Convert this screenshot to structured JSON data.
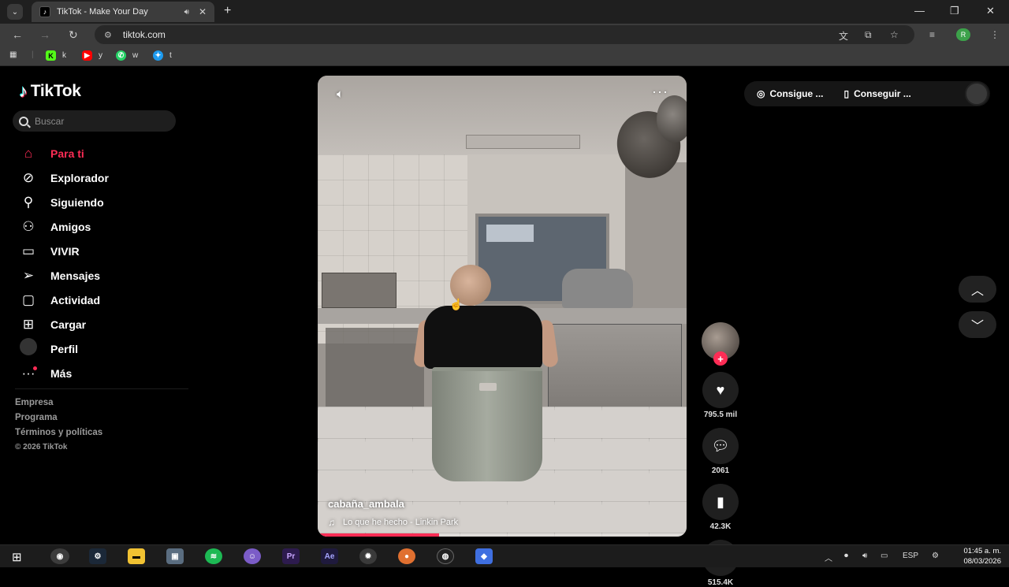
{
  "browser": {
    "tab_title": "TikTok - Make Your Day",
    "url": "tiktok.com",
    "profile_initial": "R",
    "bookmarks": [
      {
        "label": "k",
        "icon": "kick-icon"
      },
      {
        "label": "y",
        "icon": "youtube-icon"
      },
      {
        "label": "w",
        "icon": "whatsapp-icon"
      },
      {
        "label": "t",
        "icon": "twitter-icon"
      }
    ]
  },
  "sidebar": {
    "logo": "TikTok",
    "search_placeholder": "Buscar",
    "nav": [
      {
        "label": "Para ti",
        "icon": "home-icon",
        "active": true
      },
      {
        "label": "Explorador",
        "icon": "compass-icon"
      },
      {
        "label": "Siguiendo",
        "icon": "following-icon"
      },
      {
        "label": "Amigos",
        "icon": "friends-icon"
      },
      {
        "label": "VIVIR",
        "icon": "live-icon"
      },
      {
        "label": "Mensajes",
        "icon": "messages-icon"
      },
      {
        "label": "Actividad",
        "icon": "activity-icon"
      },
      {
        "label": "Cargar",
        "icon": "upload-icon"
      },
      {
        "label": "Perfil",
        "icon": "avatar"
      },
      {
        "label": "Más",
        "icon": "more-icon"
      }
    ],
    "footer_links": [
      "Empresa",
      "Programa",
      "Términos y políticas"
    ],
    "copyright": "© 2026 TikTok"
  },
  "video": {
    "author": "cabaña_ambala",
    "music": "Lo que he hecho - Linkin Park",
    "progress": 0.33
  },
  "actions": {
    "likes": "795.5 mil",
    "comments": "2061",
    "saves": "42.3K",
    "shares": "515.4K"
  },
  "top_right": {
    "btn1": "Consigue ...",
    "btn2": "Conseguir ..."
  },
  "taskbar": {
    "lang": "ESP",
    "time": "01:45 a. m.",
    "date": "08/03/2026"
  }
}
